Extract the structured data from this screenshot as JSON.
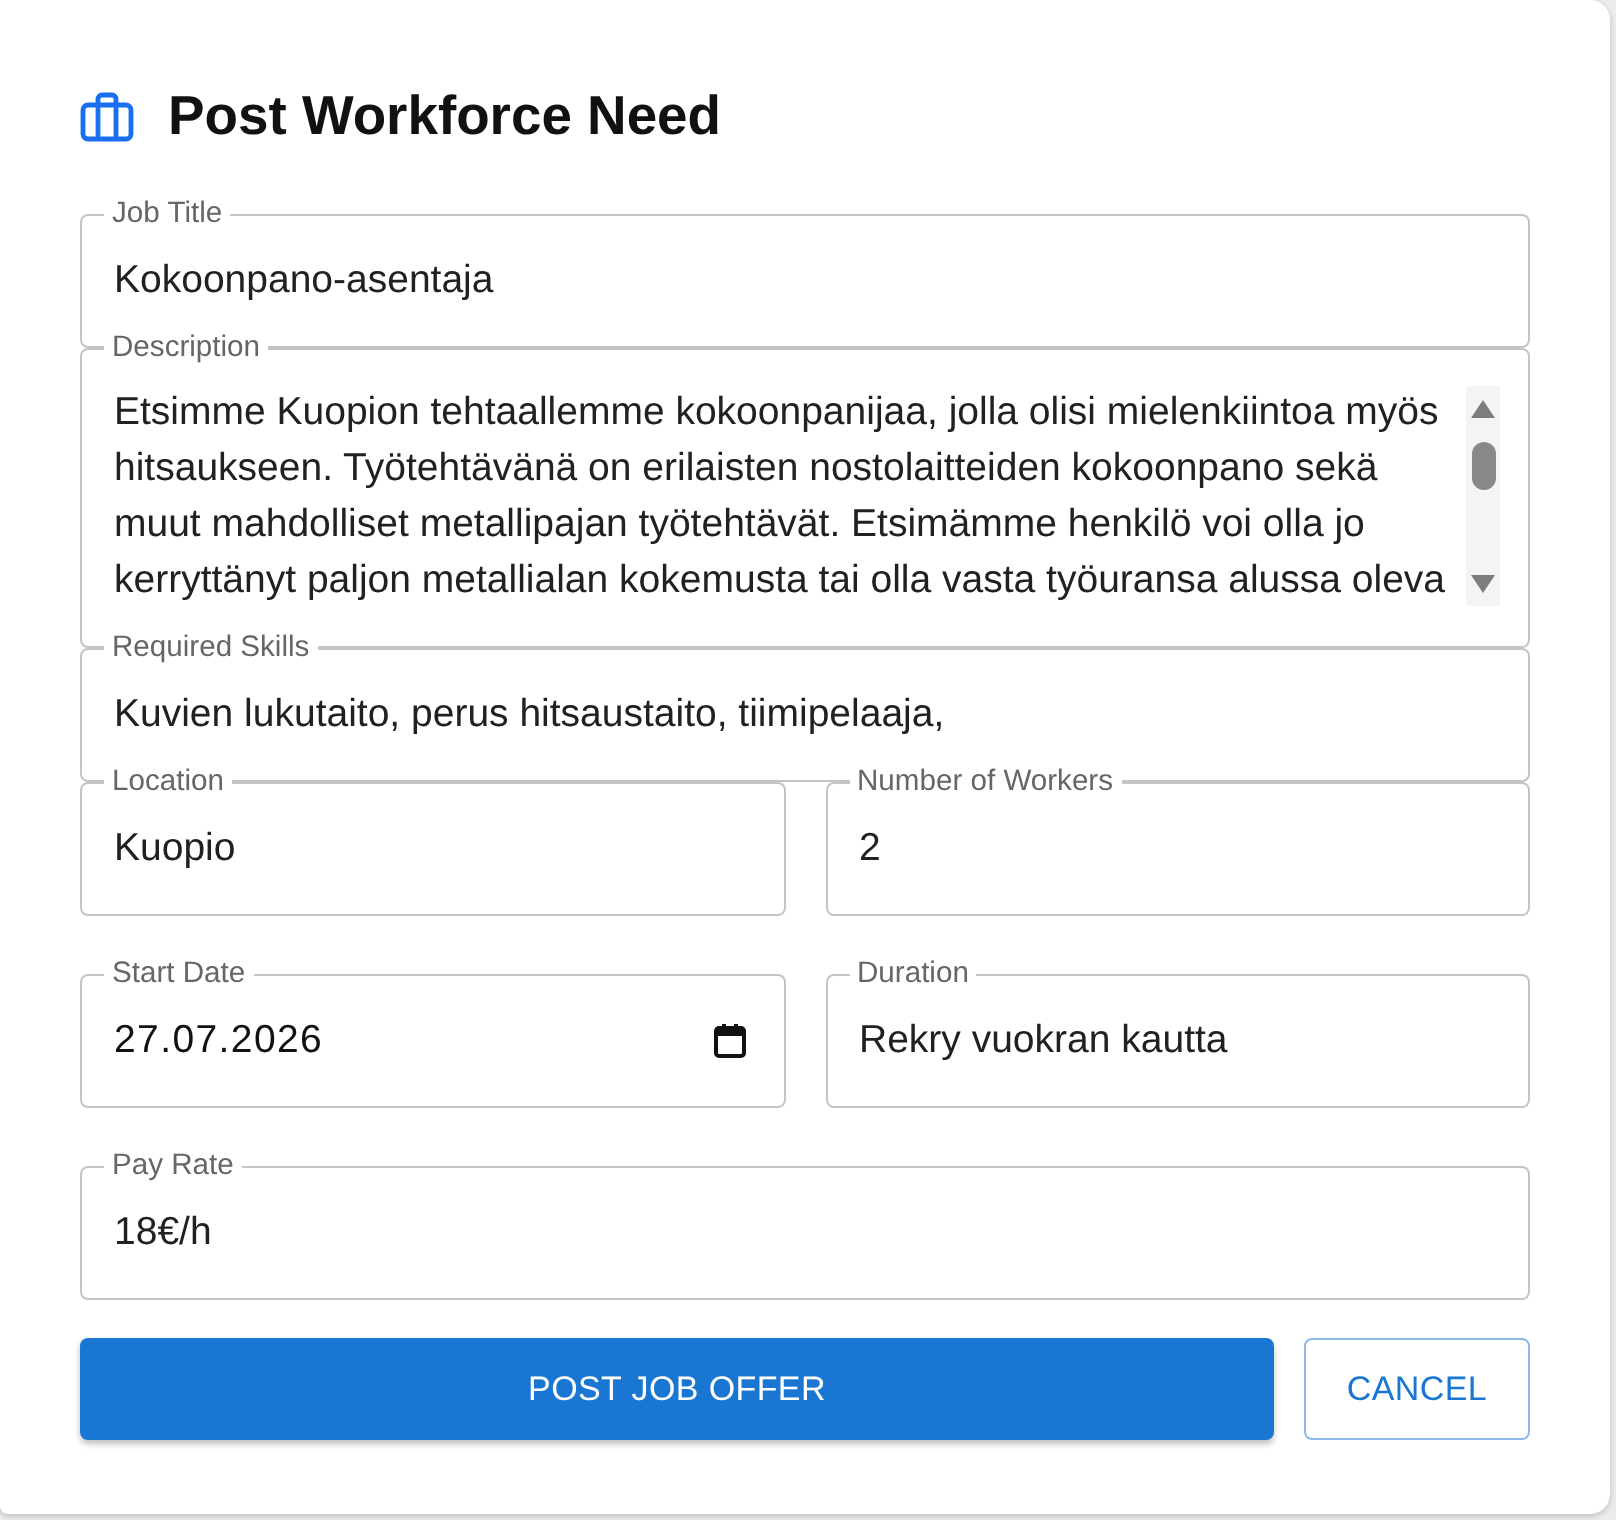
{
  "header": {
    "title": "Post Workforce Need"
  },
  "form": {
    "rows": [
      [
        {
          "kind": "text",
          "label": "Job Title",
          "value": "Kokoonpano-asentaja"
        }
      ],
      [
        {
          "kind": "multiline",
          "label": "Description",
          "value": "Etsimme Kuopion tehtaallemme kokoonpanijaa, jolla olisi mielenkiintoa myös hitsaukseen. Työtehtävänä on erilaisten nostolaitteiden kokoonpano sekä muut mahdolliset metallipajan työtehtävät. Etsimämme henkilö voi olla jo kerryttänyt paljon metallialan kokemusta tai olla vasta työuransa alussa oleva"
        }
      ],
      [
        {
          "kind": "text",
          "label": "Required Skills",
          "value": "Kuvien lukutaito, perus hitsaustaito, tiimipelaaja,"
        }
      ],
      [
        {
          "kind": "text",
          "label": "Location",
          "value": "Kuopio"
        },
        {
          "kind": "text",
          "label": "Number of Workers",
          "value": "2"
        }
      ],
      [
        {
          "kind": "date",
          "label": "Start Date",
          "value": "27.07.2026"
        },
        {
          "kind": "text",
          "label": "Duration",
          "value": "Rekry vuokran kautta"
        }
      ],
      [
        {
          "kind": "text",
          "label": "Pay Rate",
          "value": "18€/h"
        }
      ]
    ]
  },
  "buttons": [
    {
      "kind": "contained",
      "label": "POST JOB OFFER"
    },
    {
      "kind": "outlined",
      "label": "CANCEL"
    }
  ]
}
